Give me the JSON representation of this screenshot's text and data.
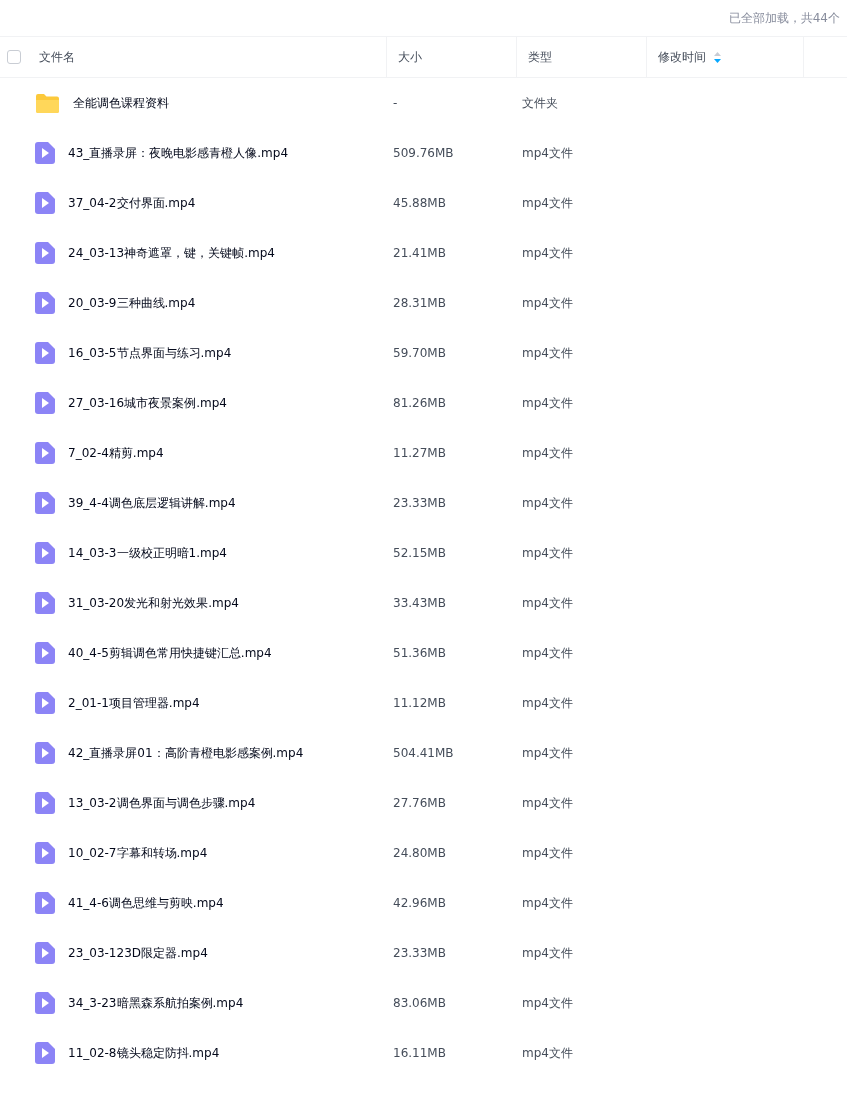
{
  "status": "已全部加载，共44个",
  "header": {
    "checked": false,
    "columns": [
      "文件名",
      "大小",
      "类型",
      "修改时间"
    ]
  },
  "rows": [
    {
      "kind": "folder",
      "name": "全能调色课程资料",
      "size": "-",
      "type": "文件夹"
    },
    {
      "kind": "video",
      "name": "43_直播录屏：夜晚电影感青橙人像.mp4",
      "size": "509.76MB",
      "type": "mp4文件"
    },
    {
      "kind": "video",
      "name": "37_04-2交付界面.mp4",
      "size": "45.88MB",
      "type": "mp4文件"
    },
    {
      "kind": "video",
      "name": "24_03-13神奇遮罩，键，关键帧.mp4",
      "size": "21.41MB",
      "type": "mp4文件"
    },
    {
      "kind": "video",
      "name": "20_03-9三种曲线.mp4",
      "size": "28.31MB",
      "type": "mp4文件"
    },
    {
      "kind": "video",
      "name": "16_03-5节点界面与练习.mp4",
      "size": "59.70MB",
      "type": "mp4文件"
    },
    {
      "kind": "video",
      "name": "27_03-16城市夜景案例.mp4",
      "size": "81.26MB",
      "type": "mp4文件"
    },
    {
      "kind": "video",
      "name": "7_02-4精剪.mp4",
      "size": "11.27MB",
      "type": "mp4文件"
    },
    {
      "kind": "video",
      "name": "39_4-4调色底层逻辑讲解.mp4",
      "size": "23.33MB",
      "type": "mp4文件"
    },
    {
      "kind": "video",
      "name": "14_03-3一级校正明暗1.mp4",
      "size": "52.15MB",
      "type": "mp4文件"
    },
    {
      "kind": "video",
      "name": "31_03-20发光和射光效果.mp4",
      "size": "33.43MB",
      "type": "mp4文件"
    },
    {
      "kind": "video",
      "name": "40_4-5剪辑调色常用快捷键汇总.mp4",
      "size": "51.36MB",
      "type": "mp4文件"
    },
    {
      "kind": "video",
      "name": "2_01-1项目管理器.mp4",
      "size": "11.12MB",
      "type": "mp4文件"
    },
    {
      "kind": "video",
      "name": "42_直播录屏01：高阶青橙电影感案例.mp4",
      "size": "504.41MB",
      "type": "mp4文件"
    },
    {
      "kind": "video",
      "name": "13_03-2调色界面与调色步骤.mp4",
      "size": "27.76MB",
      "type": "mp4文件"
    },
    {
      "kind": "video",
      "name": "10_02-7字幕和转场.mp4",
      "size": "24.80MB",
      "type": "mp4文件"
    },
    {
      "kind": "video",
      "name": "41_4-6调色思维与剪映.mp4",
      "size": "42.96MB",
      "type": "mp4文件"
    },
    {
      "kind": "video",
      "name": "23_03-123D限定器.mp4",
      "size": "23.33MB",
      "type": "mp4文件"
    },
    {
      "kind": "video",
      "name": "34_3-23暗黑森系航拍案例.mp4",
      "size": "83.06MB",
      "type": "mp4文件"
    },
    {
      "kind": "video",
      "name": "11_02-8镜头稳定防抖.mp4",
      "size": "16.11MB",
      "type": "mp4文件"
    }
  ]
}
